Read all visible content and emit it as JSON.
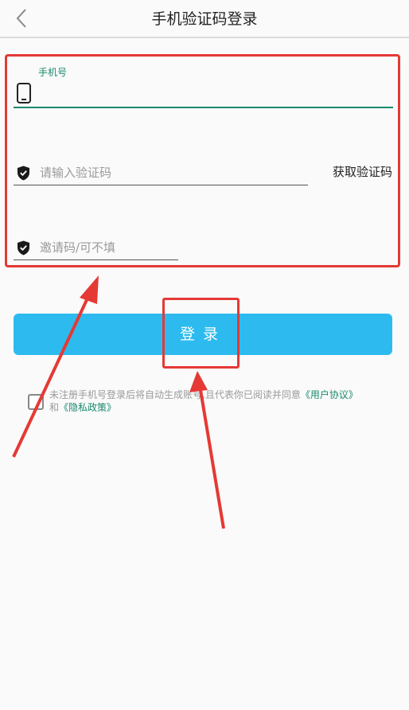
{
  "header": {
    "title": "手机验证码登录"
  },
  "form": {
    "phone_label": "手机号",
    "phone_value": "",
    "code_placeholder": "请输入验证码",
    "get_code_label": "获取验证码",
    "invite_placeholder": "邀请码/可不填"
  },
  "login": {
    "button_label": "登录"
  },
  "agreement": {
    "checked": false,
    "text_part1": "未注册手机号登录后将自动生成账号,且代表你已阅读并同意",
    "user_agreement_link": "《用户协议》",
    "conjunction": "和",
    "privacy_link": "《隐私政策》"
  },
  "colors": {
    "accent": "#1a8a6e",
    "button": "#2dbbef",
    "annotation": "#e53935"
  }
}
